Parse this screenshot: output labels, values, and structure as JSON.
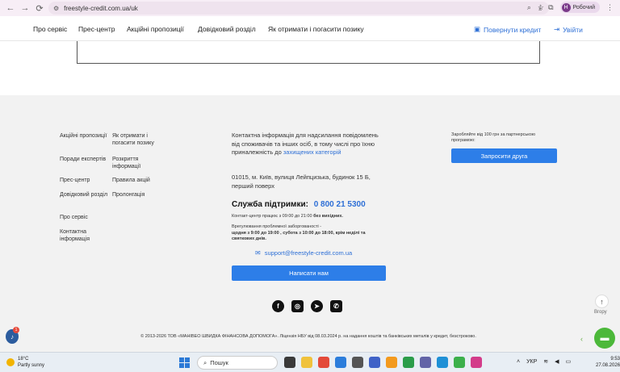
{
  "browser": {
    "url": "freestyle-credit.com.ua/uk",
    "profile_initial": "Н",
    "profile_name": "Робочий"
  },
  "header": {
    "nav": [
      "Про сервіс",
      "Прес-центр",
      "Акційні пропозиції",
      "Довідковий розділ",
      "Як отримати і погасити позику"
    ],
    "return_credit": "Повернути кредит",
    "login": "Увійти"
  },
  "footer": {
    "col1": [
      "Акційні пропозиції",
      "Поради експертів",
      "Прес-центр",
      "Довідковий розділ",
      "Про сервіс",
      "Контактна інформація"
    ],
    "col2": [
      "Як отримати і погасити позику",
      "Розкриття інформації",
      "Правила акцій",
      "Пролонгація"
    ],
    "contact_text": "Контактна інформація для надсилання повідомлень від споживачів та інших осіб, в тому числі про їхню приналежність до",
    "contact_link": "захищених категорій",
    "address": "01015, м. Київ, вулиця Лейпцизька, будинок 15 Б, перший поверх",
    "support_label": "Служба підтримки:",
    "support_phone": "0 800 21 5300",
    "hours_prefix": "Контакт-центр працює з 09:00 до 21:00",
    "hours_bold": "без вихідних.",
    "complaints_title": "Врегулювання проблемної заборгованості -",
    "complaints_hours": "щодня з 9:00 до 19:00 , субота з 10:00 до 18:00, крім неділі та святкових днів.",
    "email": "support@freestyle-credit.com.ua",
    "write_button": "Написати нам",
    "promo_text": "Заробляйте від 100 грн за партнерською програмою:",
    "invite_button": "Запросити друга",
    "copyright": "© 2013-2026 ТОВ «МАНІВЕО ШВИДКА ФІНАНСОВА ДОПОМОГА». Ліцензія НБУ від 08.03.2024 р. на надання коштів та банківських металів у кредит, безстроково.",
    "up_label": "Вгору",
    "bell_badge": "1"
  },
  "taskbar": {
    "temp": "18°C",
    "weather": "Partly sunny",
    "search_placeholder": "Пошук",
    "lang": "УКР",
    "time": "9:53",
    "date": "27.08.2026"
  },
  "colors": {
    "accent": "#2d7ee8",
    "link": "#2d6fd6",
    "chat_green": "#4cb83a"
  }
}
